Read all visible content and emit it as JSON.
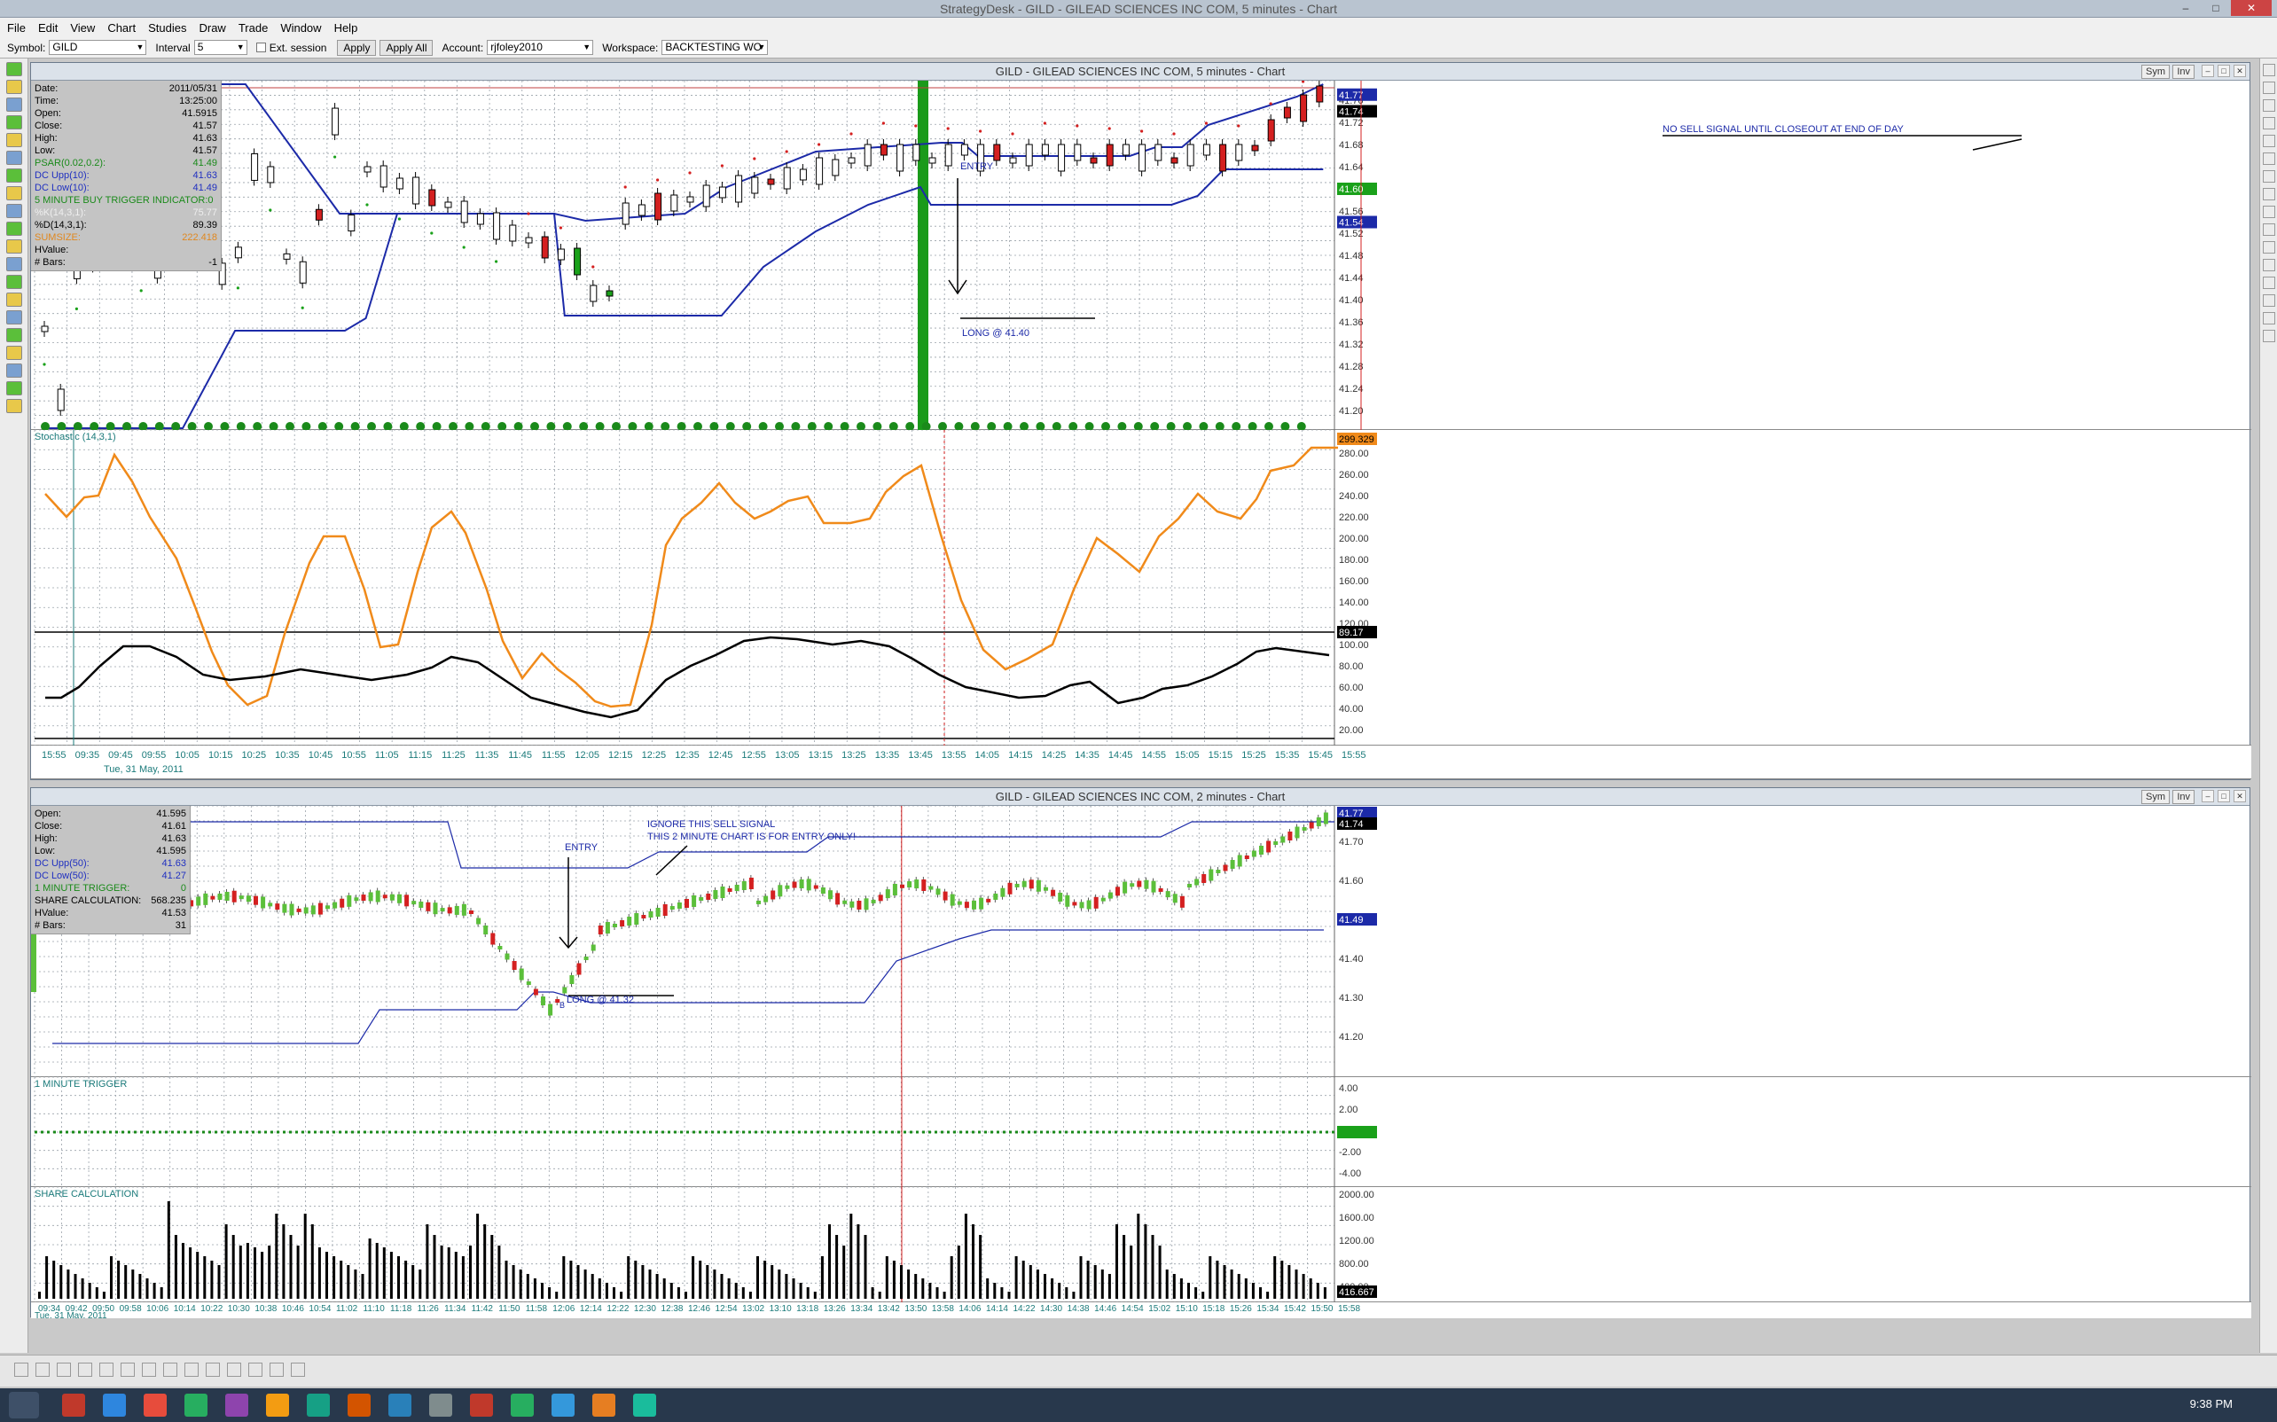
{
  "app": {
    "title": "StrategyDesk - GILD - GILEAD SCIENCES INC COM, 5 minutes - Chart"
  },
  "menu": [
    "File",
    "Edit",
    "View",
    "Chart",
    "Studies",
    "Draw",
    "Trade",
    "Window",
    "Help"
  ],
  "toolbar": {
    "symbol_label": "Symbol:",
    "symbol": "GILD",
    "interval_label": "Interval",
    "interval": "5",
    "ext_session": "Ext. session",
    "apply": "Apply",
    "apply_all": "Apply All",
    "account_label": "Account:",
    "account": "rjfoley2010",
    "workspace_label": "Workspace:",
    "workspace": "BACKTESTING WO"
  },
  "chart5": {
    "title": "GILD - GILEAD SCIENCES INC COM, 5 minutes - Chart",
    "sym": "Sym",
    "inv": "Inv",
    "info": [
      {
        "k": "Date:",
        "v": "2011/05/31",
        "c": ""
      },
      {
        "k": "Time:",
        "v": "13:25:00",
        "c": ""
      },
      {
        "k": "Open:",
        "v": "41.5915",
        "c": ""
      },
      {
        "k": "Close:",
        "v": "41.57",
        "c": ""
      },
      {
        "k": "High:",
        "v": "41.63",
        "c": ""
      },
      {
        "k": "Low:",
        "v": "41.57",
        "c": ""
      },
      {
        "k": "PSAR(0.02,0.2):",
        "v": "41.49",
        "c": "green"
      },
      {
        "k": "DC Upp(10):",
        "v": "41.63",
        "c": "blue"
      },
      {
        "k": "DC Low(10):",
        "v": "41.49",
        "c": "blue"
      },
      {
        "k": "5 MINUTE BUY TRIGGER INDICATOR:0",
        "v": "",
        "c": "green"
      },
      {
        "k": "%K(14,3,1):",
        "v": "75.77",
        "c": "gray"
      },
      {
        "k": "%D(14,3,1):",
        "v": "89.39",
        "c": ""
      },
      {
        "k": "SUMSIZE:",
        "v": "222.418",
        "c": "orange"
      },
      {
        "k": "HValue:",
        "v": "",
        "c": ""
      },
      {
        "k": "# Bars:",
        "v": "-1",
        "c": ""
      }
    ],
    "price_ticks": [
      "41.76",
      "41.72",
      "41.68",
      "41.64",
      "41.60",
      "41.56",
      "41.52",
      "41.48",
      "41.44",
      "41.40",
      "41.36",
      "41.32",
      "41.28",
      "41.24",
      "41.20"
    ],
    "price_badges": [
      "41.77",
      "41.74",
      "41.60",
      "41.54"
    ],
    "annotations": {
      "entry": "ENTRY",
      "long": "LONG @ 41.40",
      "no_sell": "NO SELL SIGNAL UNTIL CLOSEOUT AT END OF DAY"
    },
    "stoch_label": "Stochastic (14,3,1)",
    "stoch_ticks": [
      "280.00",
      "260.00",
      "240.00",
      "220.00",
      "200.00",
      "180.00",
      "160.00",
      "140.00",
      "120.00",
      "100.00",
      "80.00",
      "60.00",
      "40.00",
      "20.00"
    ],
    "stoch_badges": [
      "299.329",
      "89.17"
    ],
    "time_ticks": [
      "15:55",
      "09:35",
      "09:45",
      "09:55",
      "10:05",
      "10:15",
      "10:25",
      "10:35",
      "10:45",
      "10:55",
      "11:05",
      "11:15",
      "11:25",
      "11:35",
      "11:45",
      "11:55",
      "12:05",
      "12:15",
      "12:25",
      "12:35",
      "12:45",
      "12:55",
      "13:05",
      "13:15",
      "13:25",
      "13:35",
      "13:45",
      "13:55",
      "14:05",
      "14:15",
      "14:25",
      "14:35",
      "14:45",
      "14:55",
      "15:05",
      "15:15",
      "15:25",
      "15:35",
      "15:45",
      "15:55"
    ],
    "date_label": "Tue, 31 May, 2011"
  },
  "chart2": {
    "title": "GILD - GILEAD SCIENCES INC COM, 2 minutes - Chart",
    "sym": "Sym",
    "inv": "Inv",
    "info": [
      {
        "k": "Open:",
        "v": "41.595",
        "c": ""
      },
      {
        "k": "Close:",
        "v": "41.61",
        "c": ""
      },
      {
        "k": "High:",
        "v": "41.63",
        "c": ""
      },
      {
        "k": "Low:",
        "v": "41.595",
        "c": ""
      },
      {
        "k": "DC Upp(50):",
        "v": "41.63",
        "c": "blue"
      },
      {
        "k": "DC Low(50):",
        "v": "41.27",
        "c": "blue"
      },
      {
        "k": "1 MINUTE TRIGGER:",
        "v": "0",
        "c": "green"
      },
      {
        "k": "SHARE CALCULATION:",
        "v": "568.235",
        "c": ""
      },
      {
        "k": "HValue:",
        "v": "41.53",
        "c": ""
      },
      {
        "k": "# Bars:",
        "v": "31",
        "c": ""
      }
    ],
    "price_ticks": [
      "41.70",
      "41.60",
      "41.50",
      "41.40",
      "41.30",
      "41.20"
    ],
    "price_badges": [
      "41.77",
      "41.74",
      "41.49"
    ],
    "annotations": {
      "entry": "ENTRY",
      "long": "LONG @ 41.32",
      "ignore1": "IGNORE THIS SELL SIGNAL",
      "ignore2": "THIS 2 MINUTE CHART IS FOR ENTRY ONLY!",
      "marker": "B"
    },
    "trigger_label": "1 MINUTE TRIGGER",
    "trigger_ticks": [
      "4.00",
      "2.00",
      "0",
      "-2.00",
      "-4.00"
    ],
    "share_label": "SHARE CALCULATION",
    "share_ticks": [
      "2000.00",
      "1600.00",
      "1200.00",
      "800.00",
      "400.00"
    ],
    "share_badge": "416.667",
    "time_ticks": [
      "09:34",
      "09:42",
      "09:50",
      "09:58",
      "10:06",
      "10:14",
      "10:22",
      "10:30",
      "10:38",
      "10:46",
      "10:54",
      "11:02",
      "11:10",
      "11:18",
      "11:26",
      "11:34",
      "11:42",
      "11:50",
      "11:58",
      "12:06",
      "12:14",
      "12:22",
      "12:30",
      "12:38",
      "12:46",
      "12:54",
      "13:02",
      "13:10",
      "13:18",
      "13:26",
      "13:34",
      "13:42",
      "13:50",
      "13:58",
      "14:06",
      "14:14",
      "14:22",
      "14:30",
      "14:38",
      "14:46",
      "14:54",
      "15:02",
      "15:10",
      "15:18",
      "15:26",
      "15:34",
      "15:42",
      "15:50",
      "15:58"
    ],
    "date_label": "Tue, 31 May, 2011"
  },
  "colors": {
    "blue": "#1c2aa8",
    "orange": "#f08a1a",
    "green": "#1aa11a",
    "red": "#d42020",
    "grid": "#9aa2aa"
  },
  "clock": "9:38 PM"
}
